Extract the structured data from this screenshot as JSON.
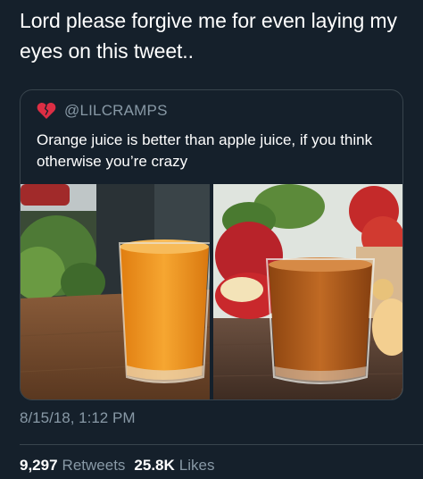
{
  "tweet": {
    "text": "Lord please forgive me for even laying my eyes on this tweet.."
  },
  "quoted_tweet": {
    "icon": "broken-heart-icon",
    "handle": "@LILCRAMPS",
    "text": "Orange juice is better than apple juice, if you think otherwise you’re crazy",
    "photos": [
      "orange-juice-photo",
      "apple-juice-photo"
    ]
  },
  "meta": {
    "timestamp": "8/15/18, 1:12 PM"
  },
  "stats": {
    "retweets_count": "9,297",
    "retweets_label": "Retweets",
    "likes_count": "25.8K",
    "likes_label": "Likes"
  },
  "colors": {
    "background": "#15202b",
    "border": "#38444d",
    "secondary_text": "#8899a6"
  }
}
